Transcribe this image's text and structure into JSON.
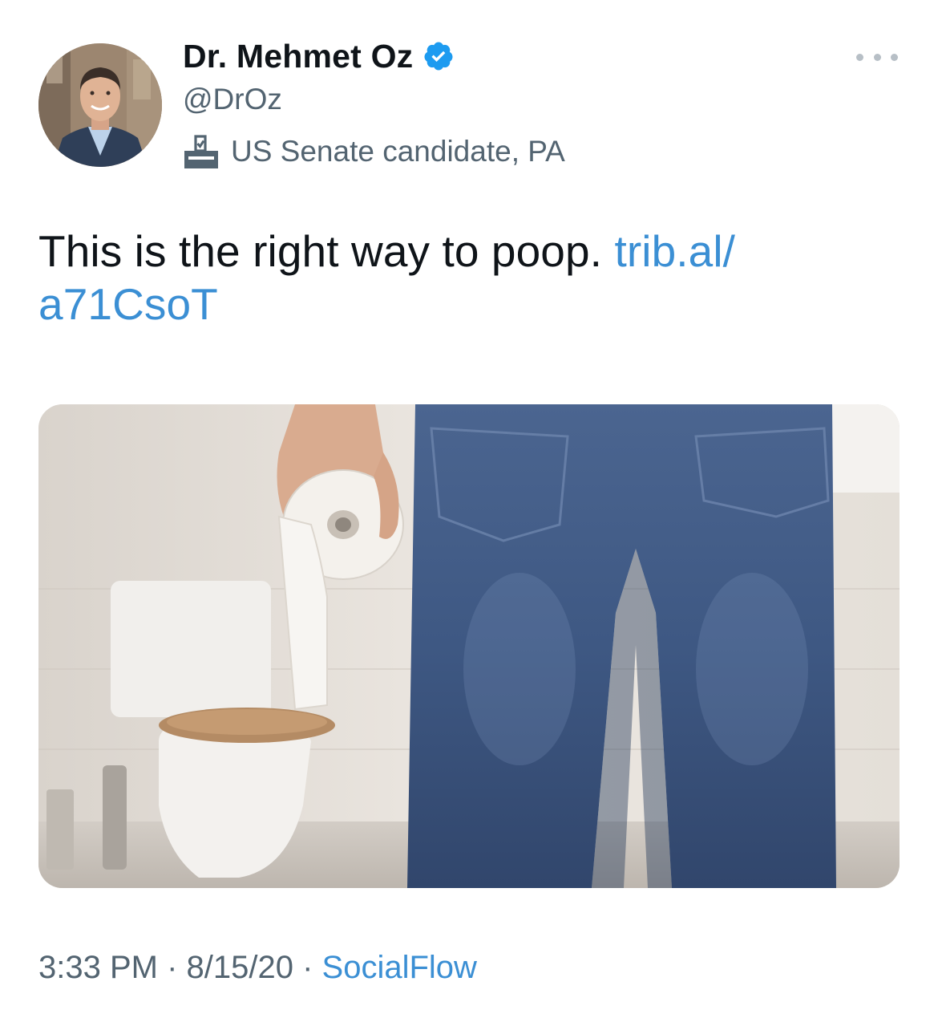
{
  "author": {
    "display_name": "Dr. Mehmet Oz",
    "handle": "@DrOz",
    "label": "US Senate candidate, PA",
    "label_icon": "ballot-box-icon",
    "verified_icon": "verified-badge-icon",
    "avatar": "profile-avatar"
  },
  "menu_icon": "more-options-icon",
  "tweet": {
    "text": "This is the right way to poop.",
    "link": "trib.al/ a71CsoT"
  },
  "media": {
    "description_icon": "attached-photo"
  },
  "meta": {
    "time": "3:33 PM",
    "sep1": " · ",
    "date": "8/15/20",
    "sep2": " · ",
    "source": "SocialFlow"
  },
  "colors": {
    "link": "#3b8fd4",
    "secondary_text": "#536471",
    "verified": "#1d9bf0"
  }
}
